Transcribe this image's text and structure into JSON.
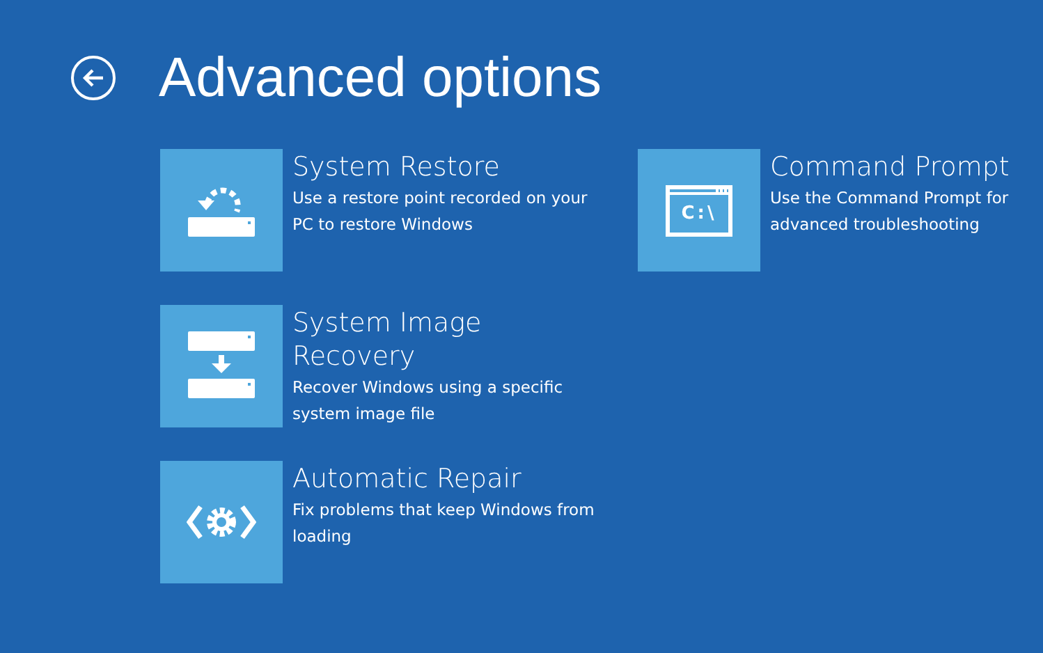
{
  "title": "Advanced options",
  "columns": [
    [
      {
        "kind": "restore",
        "title": "System Restore",
        "description": "Use a restore point recorded on your PC to restore Windows"
      },
      {
        "kind": "image",
        "title": "System Image Recovery",
        "description": "Recover Windows using a specific system image file"
      },
      {
        "kind": "repair",
        "title": "Automatic Repair",
        "description": "Fix problems that keep Windows from loading"
      }
    ],
    [
      {
        "kind": "command",
        "title": "Command Prompt",
        "description": "Use the Command Prompt for advanced troubleshooting",
        "icon_text": "C:\\"
      }
    ]
  ]
}
